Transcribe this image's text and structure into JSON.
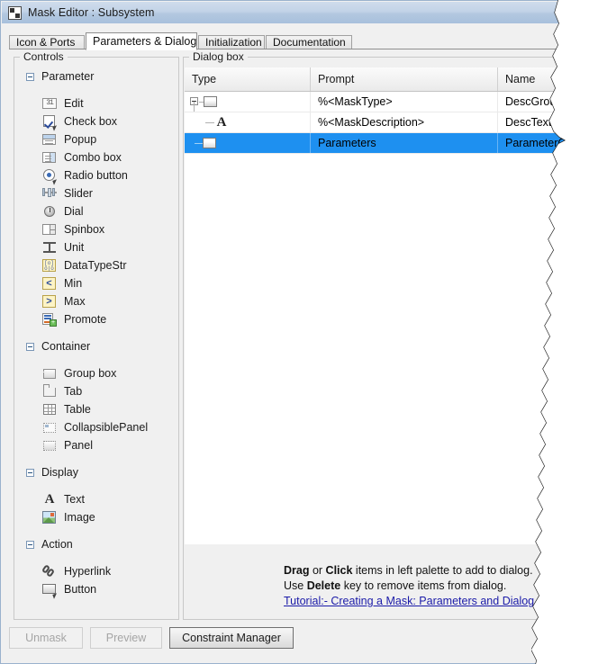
{
  "window": {
    "title": "Mask Editor : Subsystem",
    "icon": "mask-editor-icon"
  },
  "tabs": [
    {
      "label": "Icon & Ports",
      "active": false
    },
    {
      "label": "Parameters & Dialog",
      "active": true
    },
    {
      "label": "Initialization",
      "active": false
    },
    {
      "label": "Documentation",
      "active": false
    }
  ],
  "controls_panel": {
    "legend": "Controls",
    "sections": [
      {
        "name": "Parameter",
        "expanded": true,
        "items": [
          {
            "label": "Edit",
            "icon": "edit-icon"
          },
          {
            "label": "Check box",
            "icon": "checkbox-icon"
          },
          {
            "label": "Popup",
            "icon": "popup-icon"
          },
          {
            "label": "Combo box",
            "icon": "combobox-icon"
          },
          {
            "label": "Radio button",
            "icon": "radiobutton-icon"
          },
          {
            "label": "Slider",
            "icon": "slider-icon"
          },
          {
            "label": "Dial",
            "icon": "dial-icon"
          },
          {
            "label": "Spinbox",
            "icon": "spinbox-icon"
          },
          {
            "label": "Unit",
            "icon": "unit-icon"
          },
          {
            "label": "DataTypeStr",
            "icon": "datatypestr-icon"
          },
          {
            "label": "Min",
            "icon": "min-icon"
          },
          {
            "label": "Max",
            "icon": "max-icon"
          },
          {
            "label": "Promote",
            "icon": "promote-icon"
          }
        ]
      },
      {
        "name": "Container",
        "expanded": true,
        "items": [
          {
            "label": "Group box",
            "icon": "groupbox-icon"
          },
          {
            "label": "Tab",
            "icon": "tab-icon"
          },
          {
            "label": "Table",
            "icon": "table-icon"
          },
          {
            "label": "CollapsiblePanel",
            "icon": "collapsiblepanel-icon"
          },
          {
            "label": "Panel",
            "icon": "panel-icon"
          }
        ]
      },
      {
        "name": "Display",
        "expanded": true,
        "items": [
          {
            "label": "Text",
            "icon": "text-icon"
          },
          {
            "label": "Image",
            "icon": "image-icon"
          }
        ]
      },
      {
        "name": "Action",
        "expanded": true,
        "items": [
          {
            "label": "Hyperlink",
            "icon": "hyperlink-icon"
          },
          {
            "label": "Button",
            "icon": "button-icon"
          }
        ]
      }
    ]
  },
  "dialog_panel": {
    "legend": "Dialog box",
    "columns": [
      "Type",
      "Prompt",
      "Name"
    ],
    "rows": [
      {
        "type_icon": "group-icon",
        "prompt": "%<MaskType>",
        "name": "DescGroupVar",
        "depth": 0,
        "expander": "collapse",
        "selected": false
      },
      {
        "type_icon": "text-icon",
        "prompt": "%<MaskDescription>",
        "name": "DescTextVar",
        "depth": 1,
        "expander": "none",
        "selected": false
      },
      {
        "type_icon": "folder-icon",
        "prompt": "Parameters",
        "name": "ParameterGroupVar",
        "depth": 0,
        "expander": "none",
        "selected": true
      }
    ],
    "hint": {
      "line1_pre": "Drag",
      "line1_mid": " or ",
      "line1_bold2": "Click",
      "line1_post": " items in left palette to add to dialog.",
      "line2_pre": "Use ",
      "line2_bold": "Delete",
      "line2_post": " key to remove items from dialog.",
      "link": "Tutorial:- Creating a Mask: Parameters and Dialog Pane"
    }
  },
  "buttons": [
    {
      "label": "Unmask",
      "state": "disabled"
    },
    {
      "label": "Preview",
      "state": "disabled"
    },
    {
      "label": "Constraint Manager",
      "state": "enabled"
    }
  ],
  "colors": {
    "selection": "#1e90f0",
    "link": "#1a1aa8",
    "titlebar_top": "#cfdcec",
    "titlebar_bottom": "#a8c0dc",
    "panel_bg": "#f0f0f0",
    "table_bg": "#ffffff"
  }
}
